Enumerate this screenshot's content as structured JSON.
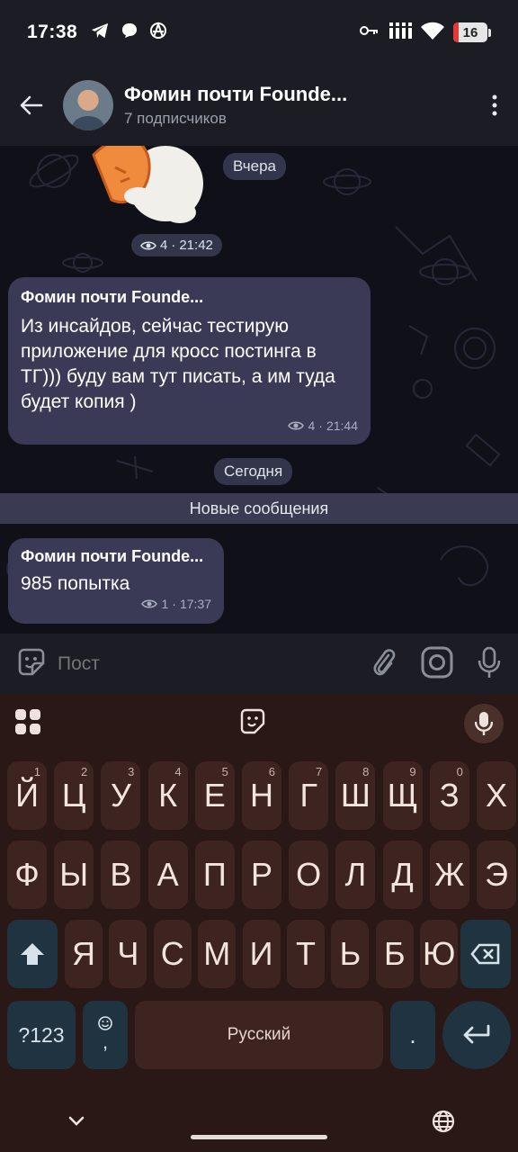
{
  "status": {
    "time": "17:38",
    "battery": "16"
  },
  "header": {
    "name": "Фомин почти Founde...",
    "subscribers": "7 подписчиков"
  },
  "chat": {
    "date_yesterday": "Вчера",
    "sticker_views": "4",
    "sticker_time": "21:42",
    "msg1": {
      "author": "Фомин почти Founde...",
      "text": "Из инсайдов, сейчас тестирую приложение для кросс постинга в ТГ))) буду вам тут писать, а им туда будет копия )",
      "views": "4",
      "time": "21:44"
    },
    "date_today": "Сегодня",
    "new_messages": "Новые сообщения",
    "msg2": {
      "author": "Фомин почти Founde...",
      "text": "985 попытка",
      "views": "1",
      "time": "17:37"
    }
  },
  "input": {
    "placeholder": "Пост"
  },
  "keyboard": {
    "row1": [
      {
        "k": "Й",
        "h": "1"
      },
      {
        "k": "Ц",
        "h": "2"
      },
      {
        "k": "У",
        "h": "3"
      },
      {
        "k": "К",
        "h": "4"
      },
      {
        "k": "Е",
        "h": "5"
      },
      {
        "k": "Н",
        "h": "6"
      },
      {
        "k": "Г",
        "h": "7"
      },
      {
        "k": "Ш",
        "h": "8"
      },
      {
        "k": "Щ",
        "h": "9"
      },
      {
        "k": "З",
        "h": "0"
      },
      {
        "k": "Х",
        "h": ""
      }
    ],
    "row2": [
      "Ф",
      "Ы",
      "В",
      "А",
      "П",
      "Р",
      "О",
      "Л",
      "Д",
      "Ж",
      "Э"
    ],
    "row3": [
      "Я",
      "Ч",
      "С",
      "М",
      "И",
      "Т",
      "Ь",
      "Б",
      "Ю"
    ],
    "symbols_label": "?123",
    "emoji_comma": ",",
    "space_label": "Русский",
    "period": "."
  },
  "colors": {
    "bubble": "#3a3a56",
    "keyboard_bg": "#2a1816",
    "key_bg": "#3d2420",
    "fn_key_bg": "#1f3340"
  }
}
